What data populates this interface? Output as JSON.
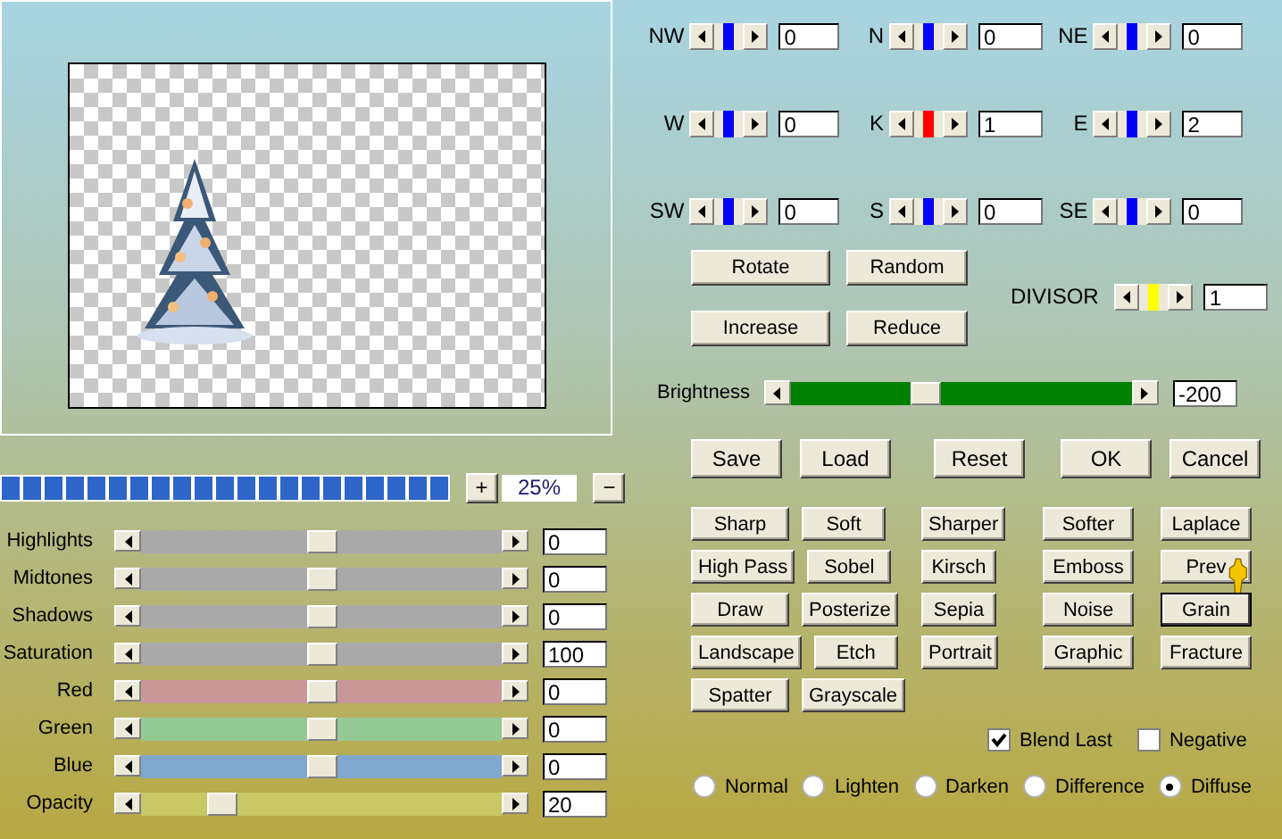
{
  "preview": {
    "kind": "picture"
  },
  "zoom": {
    "level": 1,
    "plus": "+",
    "value": "25%",
    "minus": "−"
  },
  "adjustments": [
    {
      "label": "Highlights",
      "color": "#a9a9a9",
      "level": 0.5,
      "value": "0"
    },
    {
      "label": "Midtones",
      "color": "#a9a9a9",
      "level": 0.5,
      "value": "0"
    },
    {
      "label": "Shadows",
      "color": "#a9a9a9",
      "level": 0.5,
      "value": "0"
    },
    {
      "label": "Saturation",
      "color": "#a9a9a9",
      "level": 0.5,
      "value": "100"
    },
    {
      "label": "Red",
      "color": "#c99797",
      "level": 0.5,
      "value": "0"
    },
    {
      "label": "Green",
      "color": "#94c994",
      "level": 0.5,
      "value": "0"
    },
    {
      "label": "Blue",
      "color": "#80a8cf",
      "level": 0.5,
      "value": "0"
    },
    {
      "label": "Opacity",
      "color": "#c8c866",
      "level": 0.2,
      "value": "20"
    }
  ],
  "matrix": [
    {
      "label": "NW",
      "color": "#0000ff",
      "level": 0.5,
      "value": "0"
    },
    {
      "label": "N",
      "color": "#0000ff",
      "level": 0.5,
      "value": "0"
    },
    {
      "label": "NE",
      "color": "#0000ff",
      "level": 0.5,
      "value": "0"
    },
    {
      "label": "W",
      "color": "#0000ff",
      "level": 0.5,
      "value": "0"
    },
    {
      "label": "K",
      "color": "#ff0000",
      "level": 0.5,
      "value": "1"
    },
    {
      "label": "E",
      "color": "#0000ff",
      "level": 0.5,
      "value": "2"
    },
    {
      "label": "SW",
      "color": "#0000ff",
      "level": 0.5,
      "value": "0"
    },
    {
      "label": "S",
      "color": "#0000ff",
      "level": 0.5,
      "value": "0"
    },
    {
      "label": "SE",
      "color": "#0000ff",
      "level": 0.5,
      "value": "0"
    }
  ],
  "matrix_buttons": [
    "Rotate",
    "Random",
    "Increase",
    "Reduce"
  ],
  "divisor": {
    "label": "DIVISOR",
    "color": "#ffff00",
    "level": 0.5,
    "value": "1"
  },
  "brightness": {
    "label": "Brightness",
    "level": 0.36,
    "value": "-200"
  },
  "actions": [
    "Save",
    "Load",
    "Reset",
    "OK",
    "Cancel"
  ],
  "presets": [
    [
      {
        "label": "Sharp",
        "selected": false
      },
      {
        "label": "Soft",
        "selected": false
      },
      {
        "label": "Sharper",
        "selected": false
      },
      {
        "label": "Softer",
        "selected": false
      },
      {
        "label": "Laplace",
        "selected": false
      }
    ],
    [
      {
        "label": "High Pass",
        "selected": false
      },
      {
        "label": "Sobel",
        "selected": false
      },
      {
        "label": "Kirsch",
        "selected": false
      },
      {
        "label": "Emboss",
        "selected": false
      },
      {
        "label": "Prev",
        "selected": false
      }
    ],
    [
      {
        "label": "Draw",
        "selected": false
      },
      {
        "label": "Posterize",
        "selected": false
      },
      {
        "label": "Sepia",
        "selected": false
      },
      {
        "label": "Noise",
        "selected": false
      },
      {
        "label": "Grain",
        "selected": true
      }
    ],
    [
      {
        "label": "Landscape",
        "selected": false
      },
      {
        "label": "Etch",
        "selected": false
      },
      {
        "label": "Portrait",
        "selected": false
      },
      {
        "label": "Graphic",
        "selected": false
      },
      {
        "label": "Fracture",
        "selected": false
      }
    ],
    [
      {
        "label": "Spatter",
        "selected": false
      },
      {
        "label": "Grayscale",
        "selected": false
      }
    ]
  ],
  "options": [
    {
      "label": "Blend Last",
      "checked": true
    },
    {
      "label": "Negative",
      "checked": false
    }
  ],
  "modes": [
    {
      "label": "Normal",
      "selected": false
    },
    {
      "label": "Lighten",
      "selected": false
    },
    {
      "label": "Darken",
      "selected": false
    },
    {
      "label": "Difference",
      "selected": false
    },
    {
      "label": "Diffuse",
      "selected": true
    }
  ]
}
